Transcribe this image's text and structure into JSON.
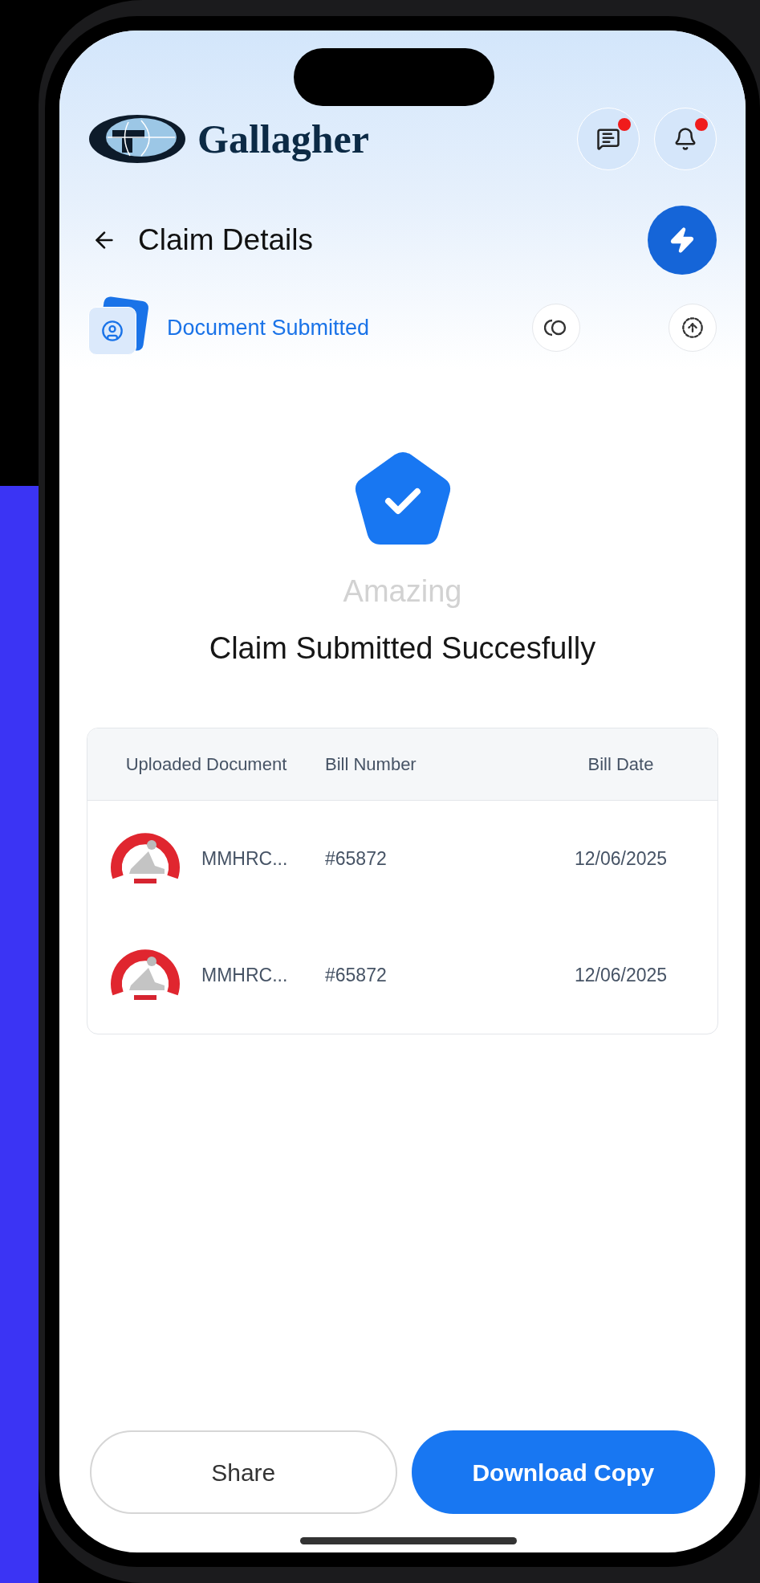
{
  "header": {
    "brand": "Gallagher",
    "chat_unread": true,
    "notifications_unread": true
  },
  "page": {
    "title": "Claim Details"
  },
  "status": {
    "label": "Document Submitted"
  },
  "result": {
    "eyebrow": "Amazing",
    "title": "Claim Submitted Succesfully"
  },
  "table": {
    "columns": [
      "Uploaded Document",
      "Bill Number",
      "Bill Date"
    ],
    "rows": [
      {
        "document": "MMHRC...",
        "bill_number": "#65872",
        "bill_date": "12/06/2025"
      },
      {
        "document": "MMHRC...",
        "bill_number": "#65872",
        "bill_date": "12/06/2025"
      }
    ]
  },
  "buttons": [
    {
      "label": "Share",
      "kind": "outline"
    },
    {
      "label": "Download Copy",
      "kind": "primary"
    }
  ]
}
